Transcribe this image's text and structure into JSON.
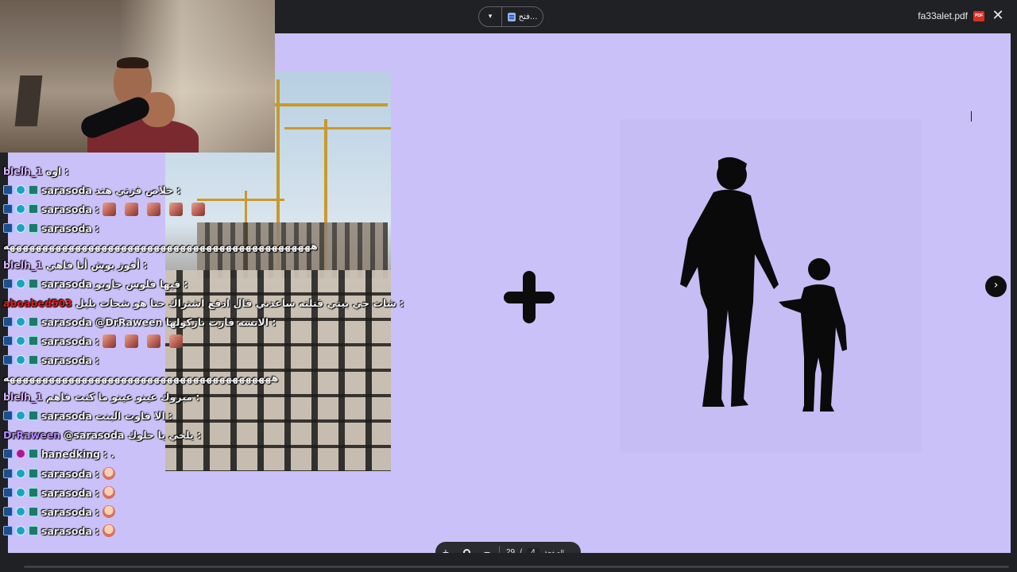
{
  "toolbar": {
    "view_label": "فتح...",
    "file_name": "fa33alet.pdf",
    "pdf_badge": "PDF",
    "close_glyph": "✕",
    "dropdown_glyph": "▾"
  },
  "icons": {
    "next_page": "›",
    "zoom_in": "+",
    "zoom_out": "−"
  },
  "page_nav": {
    "label": "الصفحة",
    "current": "4",
    "separator": "/",
    "total": "29"
  },
  "chat": {
    "messages": [
      {
        "user": "blelh_1",
        "user_color": "#d9b3ff",
        "text": "اوه :",
        "badges": []
      },
      {
        "user": "sarasoda",
        "user_color": "#f1f1f1",
        "text": "خلاص فزتي هند :",
        "badges": [
          "b1",
          "b2",
          "b3"
        ]
      },
      {
        "user": "sarasoda",
        "user_color": "#f1f1f1",
        "text": ":",
        "badges": [
          "b1",
          "b2",
          "b3"
        ],
        "emotes": 5
      },
      {
        "user": "sarasoda",
        "user_color": "#f1f1f1",
        "text": ":",
        "badges": [
          "b1",
          "b2",
          "b3"
        ]
      },
      {
        "user": "",
        "user_color": "#f1f1f1",
        "text": "هههههههههههههههههههههههههههههههههههههههههههههههه",
        "badges": []
      },
      {
        "user": "blelh_1",
        "user_color": "#d9b3ff",
        "text": "أفوز بوش أنا فاهي :",
        "badges": []
      },
      {
        "user": "sarasoda",
        "user_color": "#f1f1f1",
        "text": "فيها فلوس جاوبو :",
        "badges": [
          "b1",
          "b2",
          "b3"
        ]
      },
      {
        "user": "aboabed503",
        "user_color": "#e01f1f",
        "text": "شات جي بيتي قتلته ساعدني قال ادفع اشتراك حتا هو شحات بليل :",
        "badges": []
      },
      {
        "user": "sarasoda",
        "user_color": "#f1f1f1",
        "text": "@DrRaween الانسه فازت بازكولها :",
        "badges": [
          "b1",
          "b2",
          "b3"
        ]
      },
      {
        "user": "sarasoda",
        "user_color": "#f1f1f1",
        "text": ":",
        "badges": [
          "b1",
          "b2",
          "b3"
        ],
        "emotes": 4
      },
      {
        "user": "sarasoda",
        "user_color": "#f1f1f1",
        "text": ":",
        "badges": [
          "b1",
          "b2",
          "b3"
        ]
      },
      {
        "user": "",
        "user_color": "#f1f1f1",
        "text": "هههههههههههههههههههههههههههههههههههههههههه",
        "badges": []
      },
      {
        "user": "blelh_1",
        "user_color": "#d9b3ff",
        "text": "مبروك عينو عينو ما كنت فاهم :",
        "badges": []
      },
      {
        "user": "sarasoda",
        "user_color": "#f1f1f1",
        "text": "الا فاوت البنت :",
        "badges": [
          "b1",
          "b2",
          "b3"
        ]
      },
      {
        "user": "DrRaween",
        "user_color": "#b58cff",
        "text": "@sarasoda يلخي يا حلوك :",
        "badges": []
      },
      {
        "user": "hanedking",
        "user_color": "#f1f1f1",
        "text": ": .",
        "badges": [
          "b1",
          "b4",
          "b3"
        ]
      },
      {
        "user": "sarasoda",
        "user_color": "#f1f1f1",
        "text": ":",
        "badges": [
          "b1",
          "b2",
          "b3"
        ],
        "girl": true
      },
      {
        "user": "sarasoda",
        "user_color": "#f1f1f1",
        "text": ":",
        "badges": [
          "b1",
          "b2",
          "b3"
        ],
        "girl": true
      },
      {
        "user": "sarasoda",
        "user_color": "#f1f1f1",
        "text": ":",
        "badges": [
          "b1",
          "b2",
          "b3"
        ],
        "girl": true
      },
      {
        "user": "sarasoda",
        "user_color": "#f1f1f1",
        "text": ":",
        "badges": [
          "b1",
          "b2",
          "b3"
        ],
        "girl": true
      }
    ]
  },
  "colors": {
    "slide_bg": "#cbc1f9",
    "chrome_bg": "#202124"
  }
}
